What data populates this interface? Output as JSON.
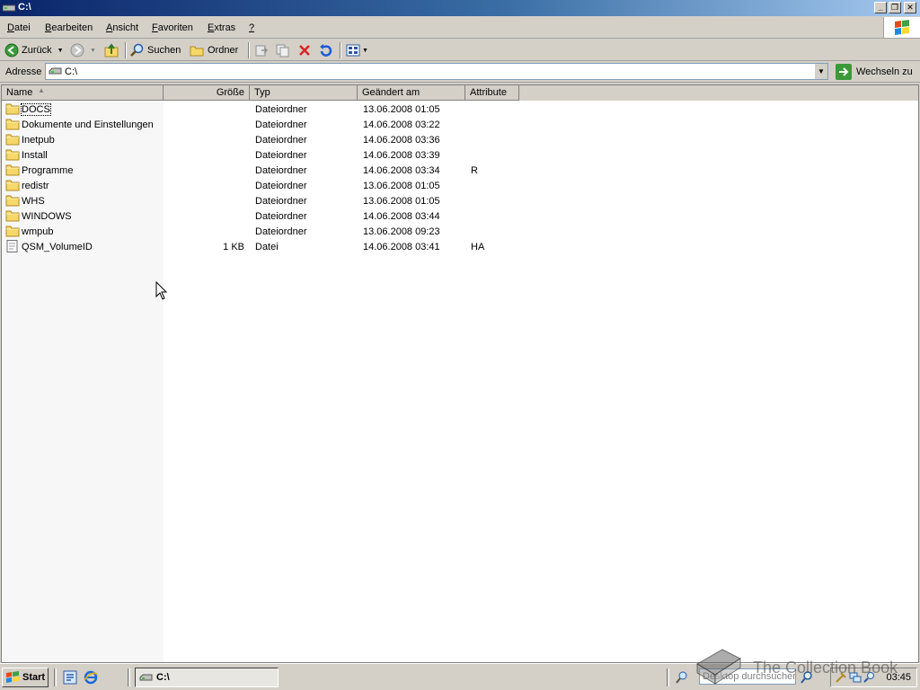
{
  "window": {
    "title": "C:\\",
    "minimize_glyph": "_",
    "restore_glyph": "❐",
    "close_glyph": "✕"
  },
  "menu": [
    {
      "label": "Datei",
      "accel": "D",
      "rest": "atei"
    },
    {
      "label": "Bearbeiten",
      "accel": "B",
      "rest": "earbeiten"
    },
    {
      "label": "Ansicht",
      "accel": "A",
      "rest": "nsicht"
    },
    {
      "label": "Favoriten",
      "accel": "F",
      "rest": "avoriten"
    },
    {
      "label": "Extras",
      "accel": "E",
      "rest": "xtras"
    },
    {
      "label": "?",
      "accel": "?",
      "rest": ""
    }
  ],
  "toolbar": {
    "back_label": "Zurück",
    "search_label": "Suchen",
    "folders_label": "Ordner"
  },
  "address": {
    "label": "Adresse",
    "value": "C:\\",
    "go_label": "Wechseln zu"
  },
  "columns": {
    "name": "Name",
    "size": "Größe",
    "type": "Typ",
    "modified": "Geändert am",
    "attributes": "Attribute"
  },
  "files": [
    {
      "name": "DOCS",
      "size": "",
      "type": "Dateiordner",
      "modified": "13.06.2008 01:05",
      "attr": "",
      "icon": "folder-icon"
    },
    {
      "name": "Dokumente und Einstellungen",
      "size": "",
      "type": "Dateiordner",
      "modified": "14.06.2008 03:22",
      "attr": "",
      "icon": "folder-icon"
    },
    {
      "name": "Inetpub",
      "size": "",
      "type": "Dateiordner",
      "modified": "14.06.2008 03:36",
      "attr": "",
      "icon": "folder-icon"
    },
    {
      "name": "Install",
      "size": "",
      "type": "Dateiordner",
      "modified": "14.06.2008 03:39",
      "attr": "",
      "icon": "folder-icon"
    },
    {
      "name": "Programme",
      "size": "",
      "type": "Dateiordner",
      "modified": "14.06.2008 03:34",
      "attr": "R",
      "icon": "folder-icon"
    },
    {
      "name": "redistr",
      "size": "",
      "type": "Dateiordner",
      "modified": "13.06.2008 01:05",
      "attr": "",
      "icon": "folder-icon"
    },
    {
      "name": "WHS",
      "size": "",
      "type": "Dateiordner",
      "modified": "13.06.2008 01:05",
      "attr": "",
      "icon": "folder-icon"
    },
    {
      "name": "WINDOWS",
      "size": "",
      "type": "Dateiordner",
      "modified": "14.06.2008 03:44",
      "attr": "",
      "icon": "folder-icon"
    },
    {
      "name": "wmpub",
      "size": "",
      "type": "Dateiordner",
      "modified": "13.06.2008 09:23",
      "attr": "",
      "icon": "folder-icon"
    },
    {
      "name": "QSM_VolumeID",
      "size": "1 KB",
      "type": "Datei",
      "modified": "14.06.2008 03:41",
      "attr": "HA",
      "icon": "file-icon"
    }
  ],
  "taskbar": {
    "start_label": "Start",
    "task_label": "C:\\",
    "search_placeholder": "Desktop durchsuchen",
    "clock": "03:45"
  },
  "watermark": "The Collection Book",
  "colors": {
    "titlebar_start": "#0a246a",
    "titlebar_end": "#a6caf0",
    "window_face": "#d4d0c8",
    "folder_yellow": "#f6d86a"
  }
}
